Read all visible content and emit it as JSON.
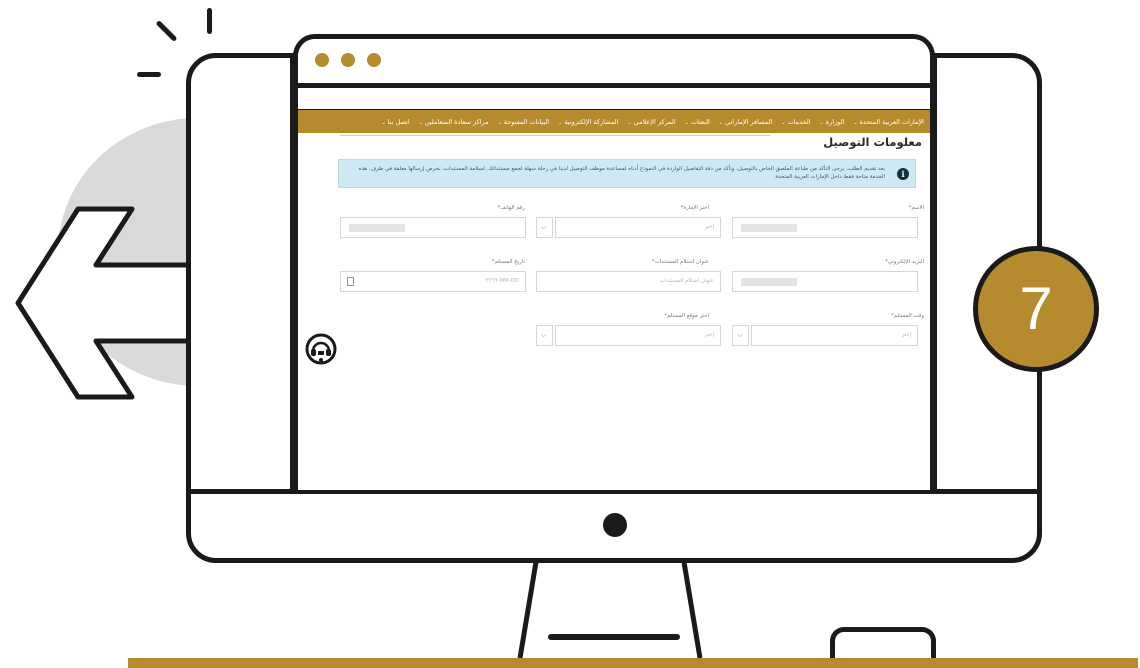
{
  "step_number": "7",
  "browser": {
    "nav_items": [
      "الإمارات العربية المتحدة",
      "الوزارة",
      "الخدمات",
      "المسافر الإماراتي",
      "البعثات",
      "المركز الإعلامي",
      "المشاركة الإلكترونية",
      "البيانات المفتوحة",
      "مراكز سعادة المتعاملين",
      "اتصل بنا"
    ]
  },
  "form": {
    "title": "معلومات التوصيل",
    "info_text": "بعد تقديم الطلب، يرجى التأكد من طباعة الملصق الخاص بالتوصيل، وتأكد من دقة التفاصيل الواردة في النموذج أدناه لمساعدة موظف التوصيل لدينا في رحلة سهلة لجمع مستنداتك. لسلامة المستندات، تحرص إرسالها مغلقة في ظرف. هذه الخدمة متاحة فقط داخل الإمارات العربية المتحدة",
    "labels": {
      "name": "الاسم",
      "emirate": "اختر الإمارة",
      "phone": "رقم الهاتف",
      "email": "البريد الإلكتروني",
      "address": "عنوان استلام المستندات",
      "pickup_date": "تاريخ المستلم",
      "pickup_time": "وقت المستلم",
      "pickup_location": "اختر موقع المستلم"
    },
    "placeholders": {
      "emirate": "إختر",
      "address": "عنوان استلام المستندات",
      "pickup_date": "YYYY-MM-DD",
      "pickup_time": "إختر",
      "pickup_location": "إختر"
    },
    "required_mark": "*"
  },
  "colors": {
    "brand_gold": "#b58b2d",
    "outline": "#1a1a1a",
    "info_bg": "#cde9f3"
  },
  "icons": {
    "back": "arrow-left-icon",
    "info": "info-icon",
    "headset": "headset-icon",
    "calendar": "calendar-icon"
  }
}
